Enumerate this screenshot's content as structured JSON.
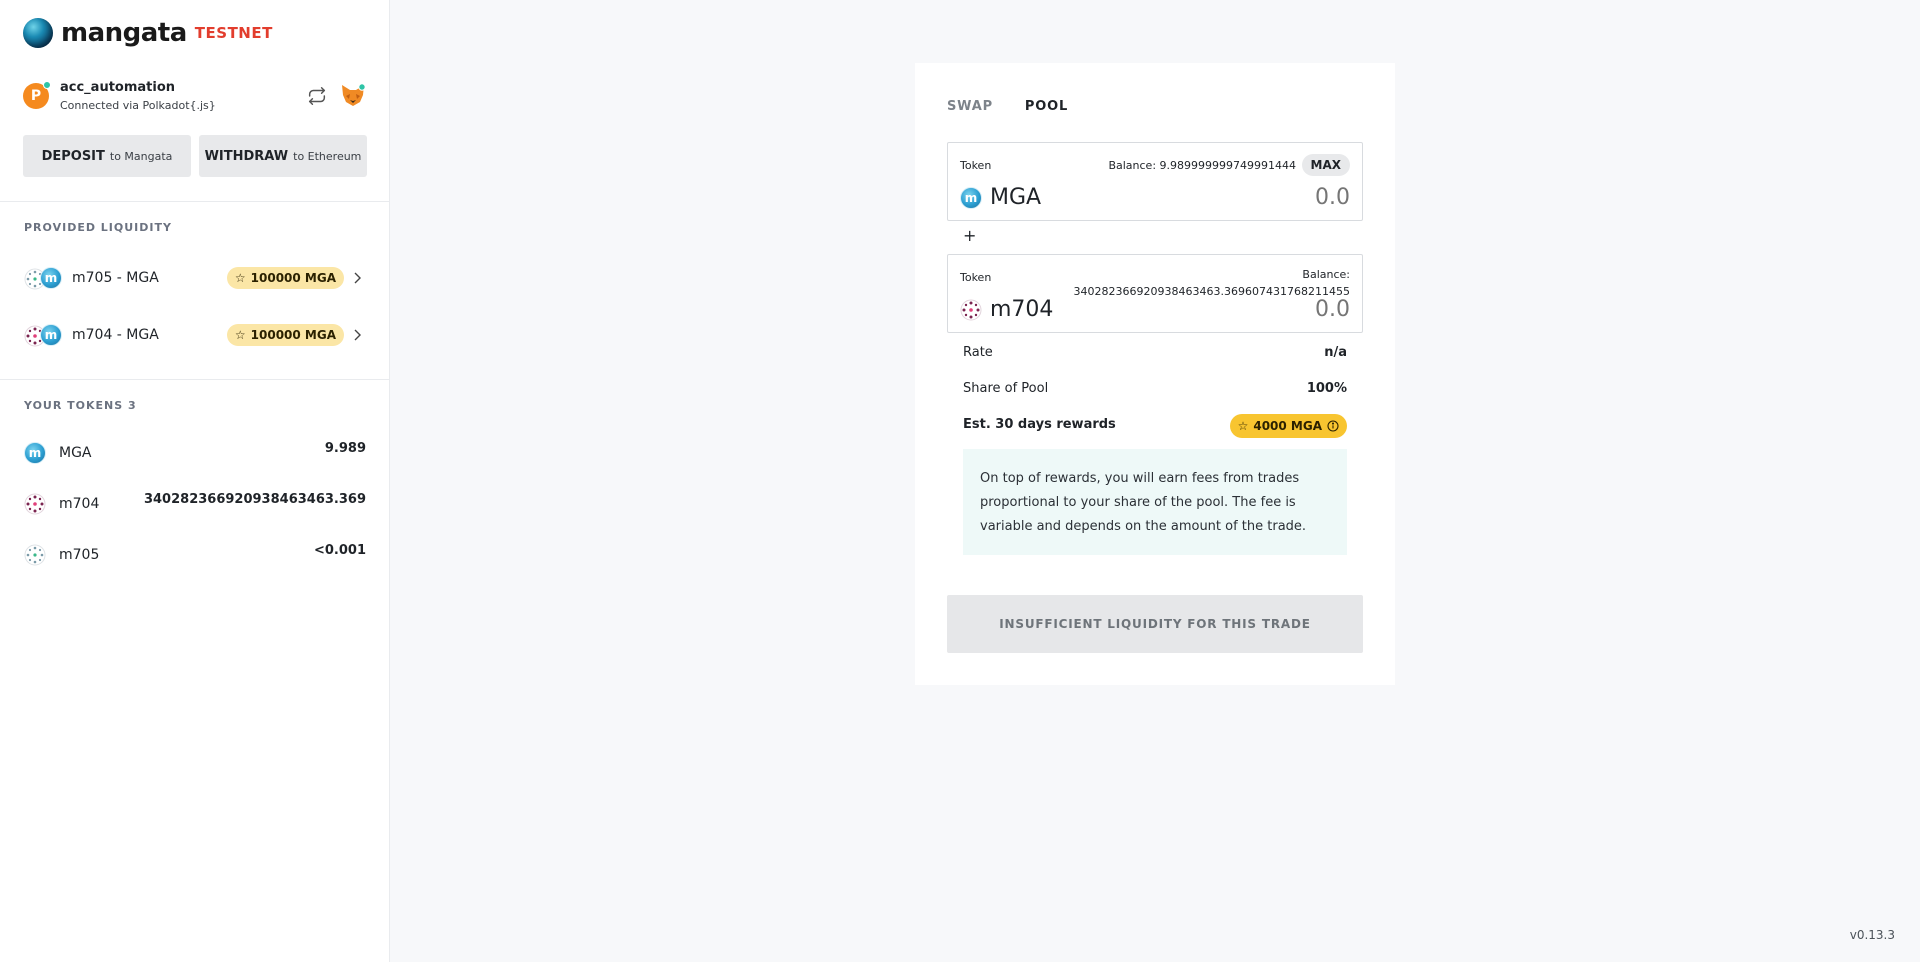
{
  "brand": {
    "name": "mangata",
    "badge": "TESTNET"
  },
  "account": {
    "name": "acc_automation",
    "connected_via": "Connected via Polkadot{.js}"
  },
  "actions": {
    "deposit_label": "DEPOSIT",
    "deposit_sub": "to Mangata",
    "withdraw_label": "WITHDRAW",
    "withdraw_sub": "to Ethereum"
  },
  "provided_liquidity": {
    "title": "PROVIDED LIQUIDITY",
    "items": [
      {
        "pair": "m705 - MGA",
        "rewards": "100000 MGA"
      },
      {
        "pair": "m704 - MGA",
        "rewards": "100000 MGA"
      }
    ]
  },
  "your_tokens": {
    "title": "YOUR TOKENS 3",
    "items": [
      {
        "symbol": "MGA",
        "balance": "9.989"
      },
      {
        "symbol": "m704",
        "balance": "340282366920938463463.369"
      },
      {
        "symbol": "m705",
        "balance": "<0.001"
      }
    ]
  },
  "version": "v0.13.3",
  "pool_card": {
    "tabs": [
      "SWAP",
      "POOL"
    ],
    "active_tab": "POOL",
    "first_token": {
      "label": "Token",
      "symbol": "MGA",
      "balance": "Balance: 9.989999999749991444",
      "max_label": "MAX",
      "amount_placeholder": "0.0"
    },
    "plus": "+",
    "second_token": {
      "label": "Token",
      "symbol": "m704",
      "balance_label": "Balance:",
      "balance_value": "340282366920938463463.369607431768211455",
      "amount_placeholder": "0.0"
    },
    "rate": {
      "label": "Rate",
      "value": "n/a"
    },
    "share": {
      "label": "Share of Pool",
      "value": "100%"
    },
    "rewards": {
      "label": "Est. 30 days rewards",
      "value": "4000 MGA"
    },
    "note": "On top of rewards, you will earn fees from trades proportional to your share of the pool. The fee is variable and depends on the amount of the trade.",
    "submit_label": "INSUFFICIENT LIQUIDITY FOR THIS TRADE"
  },
  "colors": {
    "reward_badge": "#f8c530",
    "liquidity_badge": "#fbe6a6",
    "testnet": "#e23d2d",
    "note_bg": "#eef9f8"
  }
}
